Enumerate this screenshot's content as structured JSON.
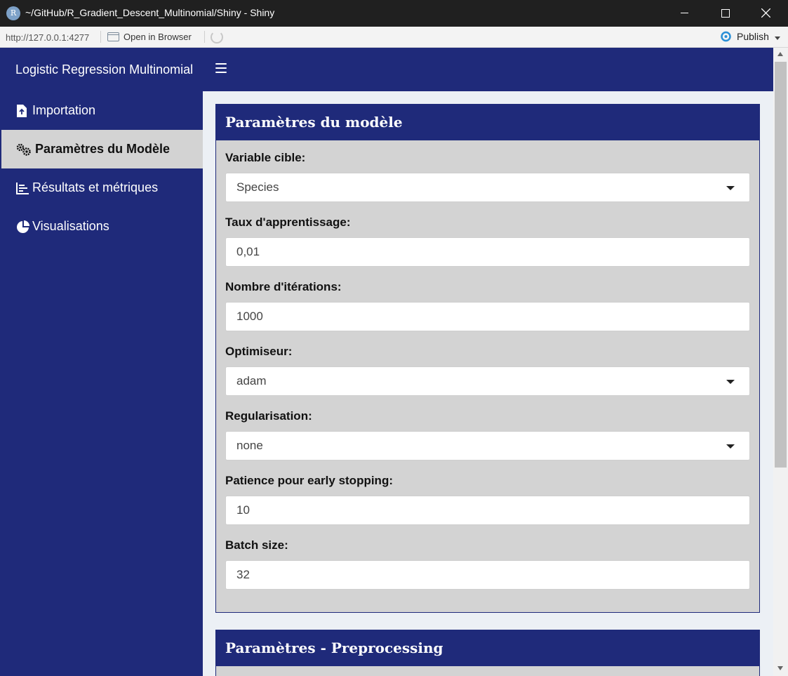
{
  "window": {
    "title": "~/GitHub/R_Gradient_Descent_Multinomial/Shiny - Shiny",
    "icon_letter": "R"
  },
  "toolbar": {
    "url": "http://127.0.0.1:4277",
    "open_in_browser": "Open in Browser",
    "publish": "Publish"
  },
  "app": {
    "brand": "Logistic Regression Multinomial",
    "menu": [
      {
        "label": "Importation",
        "icon": "file-upload-icon"
      },
      {
        "label": "Paramètres du Modèle",
        "icon": "cogs-icon",
        "active": true
      },
      {
        "label": "Résultats et métriques",
        "icon": "bar-chart-icon"
      },
      {
        "label": "Visualisations",
        "icon": "pie-chart-icon"
      }
    ]
  },
  "model_box": {
    "title": "Paramètres du modèle",
    "fields": [
      {
        "label": "Variable cible:",
        "value": "Species",
        "type": "select"
      },
      {
        "label": "Taux d'apprentissage:",
        "value": "0,01",
        "type": "input"
      },
      {
        "label": "Nombre d'itérations:",
        "value": "1000",
        "type": "input"
      },
      {
        "label": "Optimiseur:",
        "value": "adam",
        "type": "select"
      },
      {
        "label": "Regularisation:",
        "value": "none",
        "type": "select"
      },
      {
        "label": "Patience pour early stopping:",
        "value": "10",
        "type": "input"
      },
      {
        "label": "Batch size:",
        "value": "32",
        "type": "input"
      }
    ]
  },
  "preprocessing_box": {
    "title": "Paramètres - Preprocessing"
  },
  "colors": {
    "primary": "#1f2a7a",
    "box_body": "#d3d3d3",
    "content_bg": "#ecf0f5",
    "publish_accent": "#2a8fd6"
  }
}
